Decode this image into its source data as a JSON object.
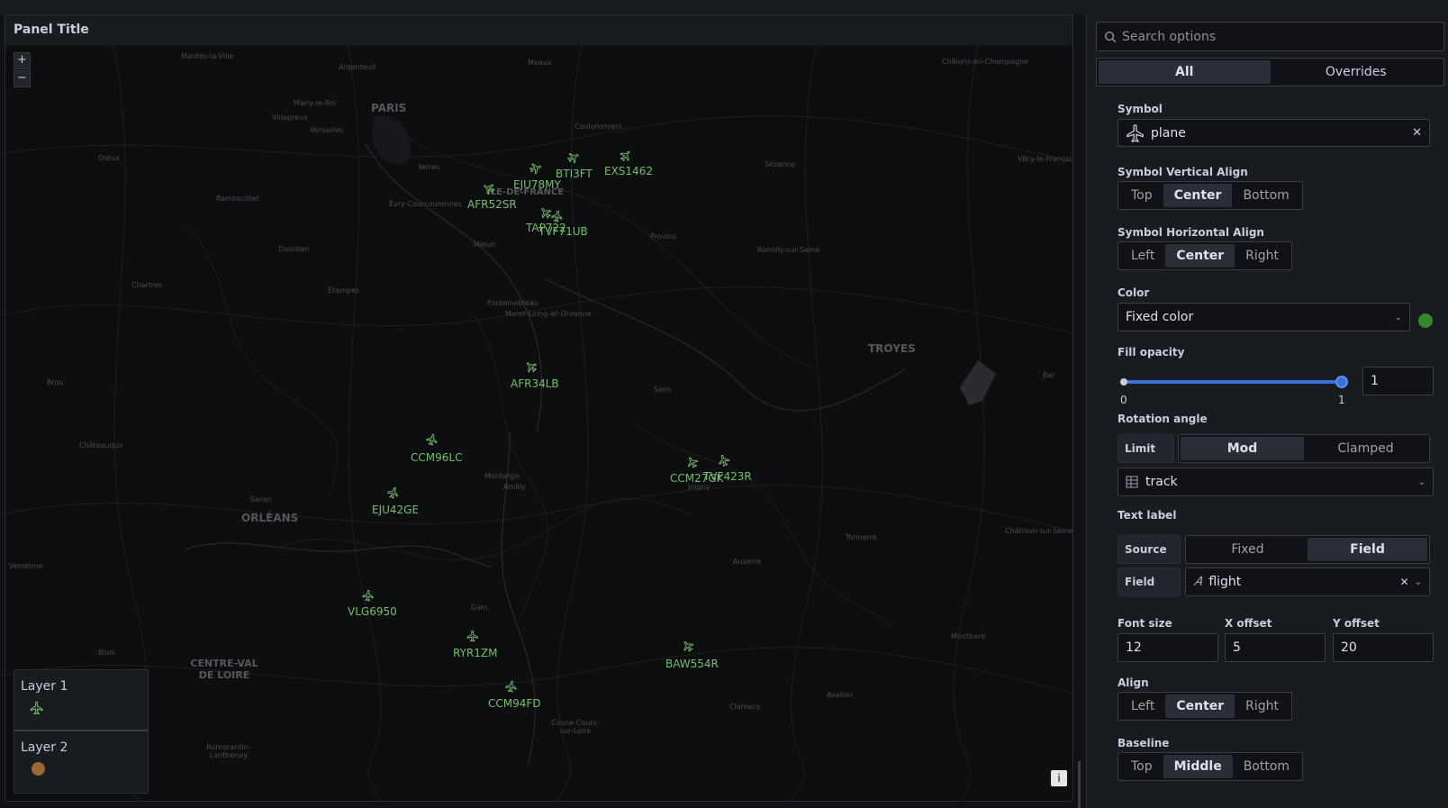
{
  "panel": {
    "title": "Panel Title",
    "zoom_in": "+",
    "zoom_out": "−",
    "info": "i"
  },
  "map_places": [
    {
      "name": "Mantes-la-Ville",
      "big": false
    },
    {
      "name": "Argenteuil",
      "big": false
    },
    {
      "name": "Meaux",
      "big": false
    },
    {
      "name": "Châlons-en-Champagne",
      "big": false
    },
    {
      "name": "PARIS",
      "big": true
    },
    {
      "name": "Marly-le-Roi",
      "big": false
    },
    {
      "name": "Villepreux",
      "big": false
    },
    {
      "name": "Versailles",
      "big": false
    },
    {
      "name": "Coulommiers",
      "big": false
    },
    {
      "name": "Dreux",
      "big": false
    },
    {
      "name": "Yerres",
      "big": false
    },
    {
      "name": "Sézanne",
      "big": false
    },
    {
      "name": "Vitry-le-François",
      "big": false
    },
    {
      "name": "Rambouillet",
      "big": false
    },
    {
      "name": "ÎLE-DE-FRANCE",
      "big": true
    },
    {
      "name": "Évry-Courcouronnes",
      "big": false
    },
    {
      "name": "Provins",
      "big": false
    },
    {
      "name": "Dourdan",
      "big": false
    },
    {
      "name": "Melun",
      "big": false
    },
    {
      "name": "Romilly-sur-Seine",
      "big": false
    },
    {
      "name": "Chartres",
      "big": false
    },
    {
      "name": "Étampes",
      "big": false
    },
    {
      "name": "Fontainebleau",
      "big": false
    },
    {
      "name": "Moret-Loing-et-Orvanne",
      "big": false
    },
    {
      "name": "TROYES",
      "big": true
    },
    {
      "name": "Brou",
      "big": false
    },
    {
      "name": "Sens",
      "big": false
    },
    {
      "name": "Bar",
      "big": false
    },
    {
      "name": "Châteaudun",
      "big": false
    },
    {
      "name": "Montargis",
      "big": false
    },
    {
      "name": "Amilly",
      "big": false
    },
    {
      "name": "Joigny",
      "big": false
    },
    {
      "name": "Saran",
      "big": false
    },
    {
      "name": "ORLÉANS",
      "big": true
    },
    {
      "name": "Tonnerre",
      "big": false
    },
    {
      "name": "Châtillon-sur-Seine",
      "big": false
    },
    {
      "name": "Vendôme",
      "big": false
    },
    {
      "name": "Auxerre",
      "big": false
    },
    {
      "name": "Gien",
      "big": false
    },
    {
      "name": "Montbard",
      "big": false
    },
    {
      "name": "Blois",
      "big": false
    },
    {
      "name": "CENTRE-VAL DE LOIRE",
      "big": true
    },
    {
      "name": "Avallon",
      "big": false
    },
    {
      "name": "Clamecy",
      "big": false
    },
    {
      "name": "Cosne-Cours-sur-Loire",
      "big": false
    },
    {
      "name": "Romorantin-Lanthenay",
      "big": false
    }
  ],
  "flights": [
    {
      "label": "EXS1462"
    },
    {
      "label": "BTI3FT"
    },
    {
      "label": "EJU78MY"
    },
    {
      "label": "AFR52SR"
    },
    {
      "label": "TAP722"
    },
    {
      "label": "TVF71UB"
    },
    {
      "label": "AFR34LB"
    },
    {
      "label": "CCM96LC"
    },
    {
      "label": "EJU42GE"
    },
    {
      "label": "CCM27GK"
    },
    {
      "label": "TVF423R"
    },
    {
      "label": "VLG6950"
    },
    {
      "label": "RYR1ZM"
    },
    {
      "label": "BAW554R"
    },
    {
      "label": "CCM94FD"
    }
  ],
  "legend": {
    "layer1": "Layer 1",
    "layer2": "Layer 2"
  },
  "options": {
    "search_placeholder": "Search options",
    "tab_all": "All",
    "tab_overrides": "Overrides",
    "symbol_label": "Symbol",
    "symbol_value": "plane",
    "symbol_valign_label": "Symbol Vertical Align",
    "symbol_valign_opts": [
      "Top",
      "Center",
      "Bottom"
    ],
    "symbol_halign_label": "Symbol Horizontal Align",
    "symbol_halign_opts": [
      "Left",
      "Center",
      "Right"
    ],
    "color_label": "Color",
    "color_value": "Fixed color",
    "color_swatch": "#37872d",
    "fill_opacity_label": "Fill opacity",
    "fill_opacity_min": "0",
    "fill_opacity_max": "1",
    "fill_opacity_value": "1",
    "rotation_label": "Rotation angle",
    "limit_label": "Limit",
    "limit_opts": [
      "Mod",
      "Clamped"
    ],
    "rotation_field": "track",
    "text_label": "Text label",
    "source_label": "Source",
    "source_opts": [
      "Fixed",
      "Field"
    ],
    "field_label": "Field",
    "field_value": "flight",
    "font_size_label": "Font size",
    "font_size_value": "12",
    "x_offset_label": "X offset",
    "x_offset_value": "5",
    "y_offset_label": "Y offset",
    "y_offset_value": "20",
    "align_label": "Align",
    "align_opts": [
      "Left",
      "Center",
      "Right"
    ],
    "baseline_label": "Baseline",
    "baseline_opts": [
      "Top",
      "Middle",
      "Bottom"
    ]
  },
  "colors": {
    "flight_green": "#73bf69",
    "accent_blue": "#3871dc",
    "layer2_dot": "#9a6a35"
  }
}
